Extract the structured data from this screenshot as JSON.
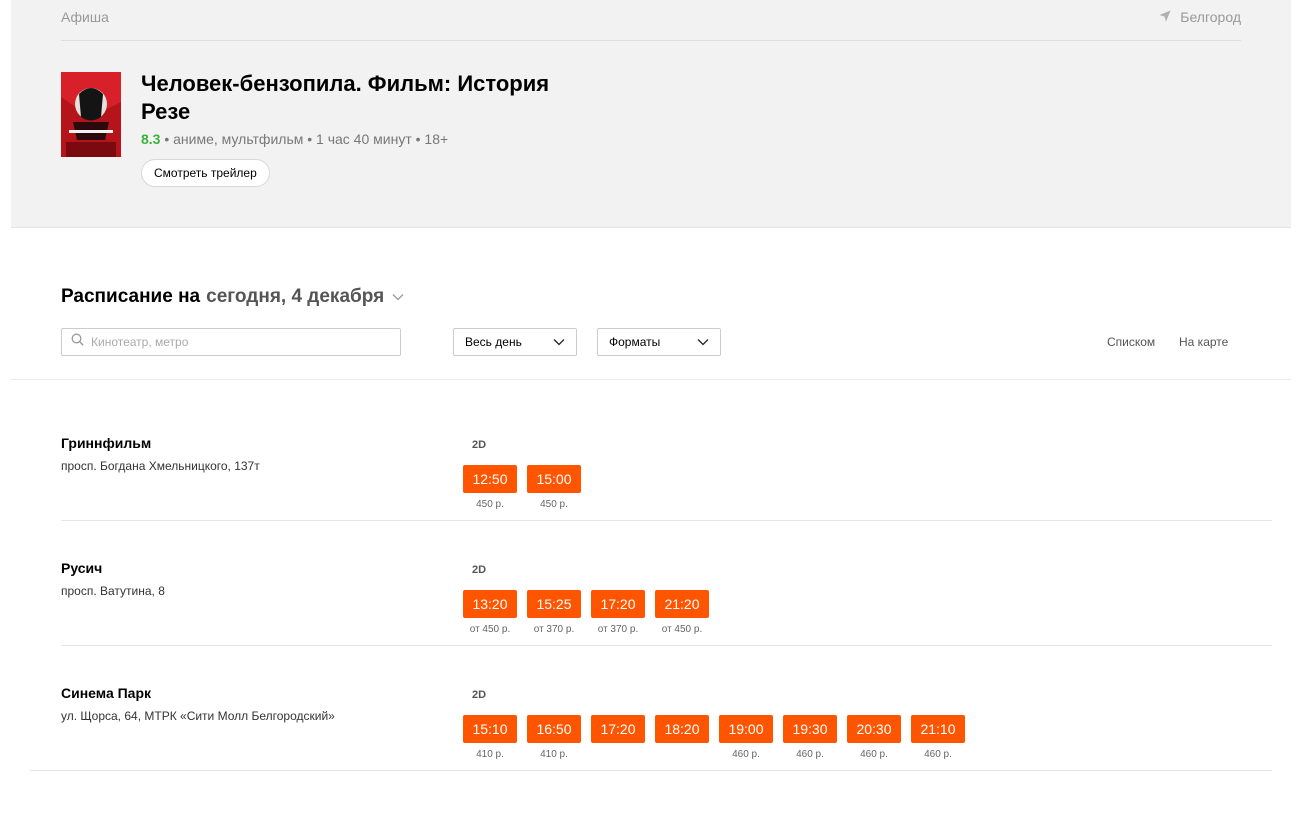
{
  "header": {
    "brand": "Афиша",
    "city": "Белгород"
  },
  "movie": {
    "title": "Человек-бензопила. Фильм: История Резе",
    "rating": "8.3",
    "meta": " • аниме, мультфильм • 1 час 40 минут • 18+",
    "trailer_label": "Смотреть трейлер"
  },
  "schedule": {
    "title": "Расписание на",
    "date": "сегодня, 4 декабря",
    "search_placeholder": "Кинотеатр, метро",
    "day_filter": "Весь день",
    "format_filter": "Форматы",
    "view_list": "Списком",
    "view_map": "На карте"
  },
  "cinemas": [
    {
      "name": "Гриннфильм",
      "address": "просп. Богдана Хмельницкого, 137т",
      "format": "2D",
      "sessions": [
        {
          "time": "12:50",
          "price": "450 р."
        },
        {
          "time": "15:00",
          "price": "450 р."
        }
      ]
    },
    {
      "name": "Русич",
      "address": "просп. Ватутина, 8",
      "format": "2D",
      "sessions": [
        {
          "time": "13:20",
          "price": "от 450 р."
        },
        {
          "time": "15:25",
          "price": "от 370 р."
        },
        {
          "time": "17:20",
          "price": "от 370 р."
        },
        {
          "time": "21:20",
          "price": "от 450 р."
        }
      ]
    },
    {
      "name": "Синема Парк",
      "address": "ул. Щорса, 64, МТРК «Сити Молл Белгородский»",
      "format": "2D",
      "sessions": [
        {
          "time": "15:10",
          "price": "410 р."
        },
        {
          "time": "16:50",
          "price": "410 р."
        },
        {
          "time": "17:20",
          "price": ""
        },
        {
          "time": "18:20",
          "price": ""
        },
        {
          "time": "19:00",
          "price": "460 р."
        },
        {
          "time": "19:30",
          "price": "460 р."
        },
        {
          "time": "20:30",
          "price": "460 р."
        },
        {
          "time": "21:10",
          "price": "460 р."
        }
      ]
    }
  ],
  "colors": {
    "accent": "#ff5500",
    "rating": "#3bb33b",
    "hero_bg": "#f2f2f2"
  }
}
